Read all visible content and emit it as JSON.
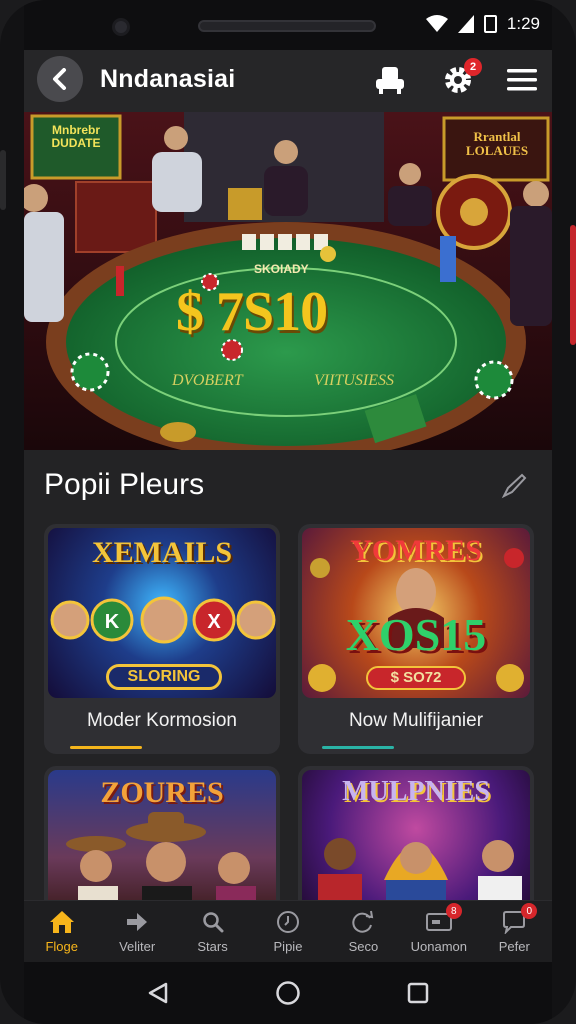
{
  "status_bar": {
    "time": "1:29"
  },
  "app_bar": {
    "title": "Nndanasiai",
    "settings_badge": "2"
  },
  "hero": {
    "sign_left": "Mnbrebr DUDATE",
    "sign_right": "Rrantlal LOLAUES",
    "table_small": "SKOIADY",
    "table_amount": "$ 7S10",
    "table_left": "DVOBERT",
    "table_right": "VIITUSIESS"
  },
  "section": {
    "title": "Popii Pleurs"
  },
  "cards": [
    {
      "label": "Moder Kormosion",
      "thumb_title": "XEMAILS",
      "thumb_sub": "SLORING",
      "accent": "#f4b51c"
    },
    {
      "label": "Now Mulifijanier",
      "thumb_title": "YOMRES",
      "thumb_big": "XOS15",
      "thumb_sub": "$ SO72",
      "accent": "#2ab3a6"
    },
    {
      "thumb_title": "ZOURES"
    },
    {
      "thumb_title": "MULPNIES"
    }
  ],
  "bottom_nav": [
    {
      "label": "Floge",
      "icon": "home-icon"
    },
    {
      "label": "Veliter",
      "icon": "arrow-icon"
    },
    {
      "label": "Stars",
      "icon": "search-icon"
    },
    {
      "label": "Pipie",
      "icon": "clock-icon"
    },
    {
      "label": "Seco",
      "icon": "refresh-icon"
    },
    {
      "label": "Uonamon",
      "icon": "ticket-icon",
      "badge": "8"
    },
    {
      "label": "Pefer",
      "icon": "chat-icon",
      "badge": "0"
    }
  ],
  "colors": {
    "accent_gold": "#f7b51b",
    "accent_teal": "#2ab3a6",
    "badge_red": "#e0262b",
    "felt_green": "#1d7a3c"
  }
}
